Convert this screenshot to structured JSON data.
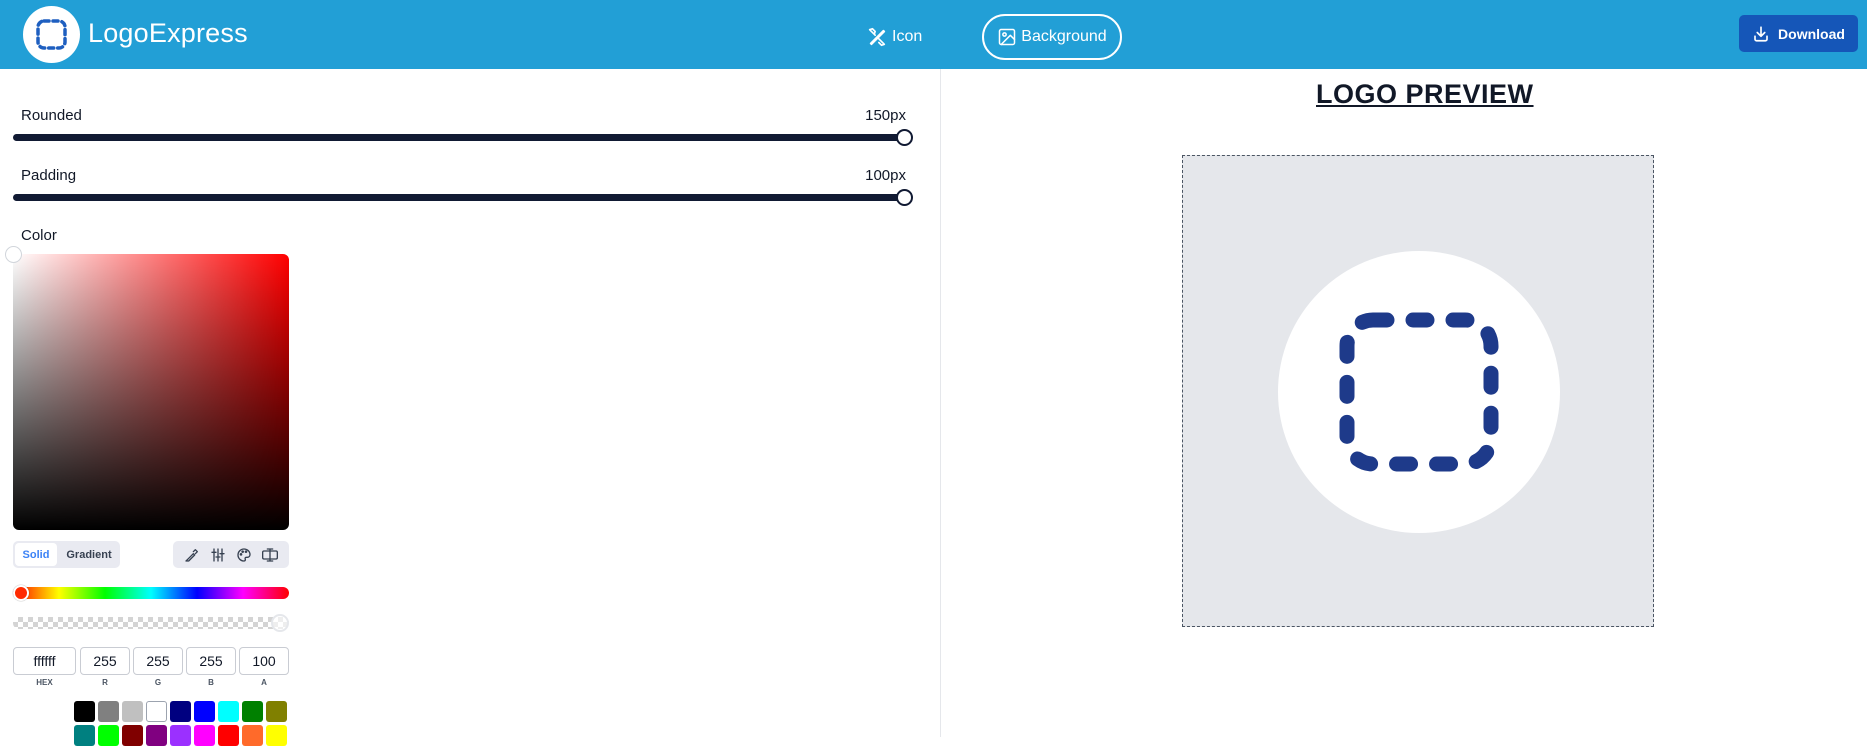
{
  "app": {
    "title": "LogoExpress"
  },
  "header": {
    "nav": [
      {
        "label": "Icon",
        "icon": "pen-ruler-icon",
        "active": false
      },
      {
        "label": "Background",
        "icon": "image-icon",
        "active": true
      }
    ],
    "download_label": "Download"
  },
  "sliders": {
    "rounded": {
      "label": "Rounded",
      "value_text": "150px",
      "fraction": 1.0
    },
    "padding": {
      "label": "Padding",
      "value_text": "100px",
      "fraction": 1.0
    }
  },
  "color_picker": {
    "label": "Color",
    "modes": [
      "Solid",
      "Gradient"
    ],
    "active_mode": "Solid",
    "tools": [
      "eyedropper-icon",
      "sliders-icon",
      "palette-icon",
      "advanced-icon"
    ],
    "hue_color": "#ff0000",
    "hue_fraction": 0.0,
    "alpha_fraction": 1.0,
    "inputs": [
      {
        "caption": "HEX",
        "value": "ffffff"
      },
      {
        "caption": "R",
        "value": "255"
      },
      {
        "caption": "G",
        "value": "255"
      },
      {
        "caption": "B",
        "value": "255"
      },
      {
        "caption": "A",
        "value": "100"
      }
    ],
    "swatches_row1": [
      "#000000",
      "#808080",
      "#c0c0c0",
      "#ffffff",
      "#000080",
      "#0000ff",
      "#00ffff",
      "#008000",
      "#808000"
    ],
    "swatches_row2": [
      "#008080",
      "#00ff00",
      "#800000",
      "#800080",
      "#9b30ff",
      "#ff00ff",
      "#ff0000",
      "#ff6a2a",
      "#ffff00"
    ]
  },
  "preview": {
    "title": "LOGO PREVIEW",
    "background_color": "#ffffff",
    "icon_color": "#1e3a8a",
    "icon": "dashed-square-icon"
  },
  "colors": {
    "header_bg": "#229fd6",
    "download_bg": "#1556b8"
  }
}
